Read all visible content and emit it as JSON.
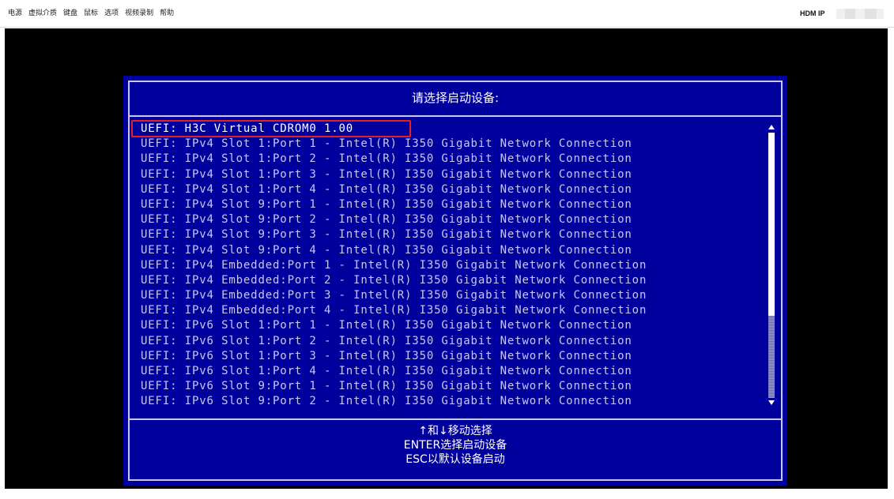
{
  "menubar": {
    "items": [
      "电源",
      "虚拟介质",
      "键盘",
      "鼠标",
      "选项",
      "视频录制",
      "帮助"
    ],
    "hdm_ip_label": "HDM IP"
  },
  "dialog": {
    "title": "请选择启动设备:",
    "selected_index": 0,
    "devices": [
      "UEFI: H3C Virtual CDROM0 1.00",
      "UEFI: IPv4 Slot 1:Port 1 - Intel(R) I350 Gigabit Network Connection",
      "UEFI: IPv4 Slot 1:Port 2 - Intel(R) I350 Gigabit Network Connection",
      "UEFI: IPv4 Slot 1:Port 3 - Intel(R) I350 Gigabit Network Connection",
      "UEFI: IPv4 Slot 1:Port 4 - Intel(R) I350 Gigabit Network Connection",
      "UEFI: IPv4 Slot 9:Port 1 - Intel(R) I350 Gigabit Network Connection",
      "UEFI: IPv4 Slot 9:Port 2 - Intel(R) I350 Gigabit Network Connection",
      "UEFI: IPv4 Slot 9:Port 3 - Intel(R) I350 Gigabit Network Connection",
      "UEFI: IPv4 Slot 9:Port 4 - Intel(R) I350 Gigabit Network Connection",
      "UEFI: IPv4 Embedded:Port 1 - Intel(R) I350 Gigabit Network Connection",
      "UEFI: IPv4 Embedded:Port 2 - Intel(R) I350 Gigabit Network Connection",
      "UEFI: IPv4 Embedded:Port 3 - Intel(R) I350 Gigabit Network Connection",
      "UEFI: IPv4 Embedded:Port 4 - Intel(R) I350 Gigabit Network Connection",
      "UEFI: IPv6 Slot 1:Port 1 - Intel(R) I350 Gigabit Network Connection",
      "UEFI: IPv6 Slot 1:Port 2 - Intel(R) I350 Gigabit Network Connection",
      "UEFI: IPv6 Slot 1:Port 3 - Intel(R) I350 Gigabit Network Connection",
      "UEFI: IPv6 Slot 1:Port 4 - Intel(R) I350 Gigabit Network Connection",
      "UEFI: IPv6 Slot 9:Port 1 - Intel(R) I350 Gigabit Network Connection",
      "UEFI: IPv6 Slot 9:Port 2 - Intel(R) I350 Gigabit Network Connection"
    ],
    "help": {
      "line1": "↑和↓移动选择",
      "line2": "ENTER选择启动设备",
      "line3": "ESC以默认设备启动"
    }
  },
  "colors": {
    "dialog_bg": "#00009c",
    "highlight_border": "#e62020",
    "text": "#c8c8ee"
  }
}
